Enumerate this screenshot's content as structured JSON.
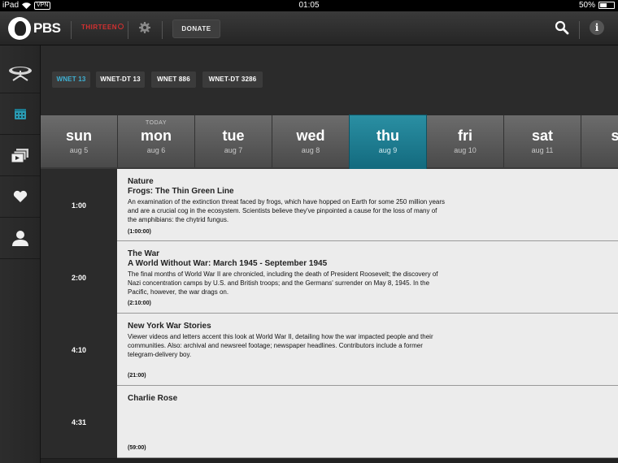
{
  "status_bar": {
    "device": "iPad",
    "vpn": "VPN",
    "time": "01:05",
    "battery": "50%",
    "battery_level": 0.5
  },
  "header": {
    "logo_text": "PBS",
    "station_logo": "THIRTEEN",
    "donate_label": "DONATE",
    "icons": [
      "pbs-head-icon",
      "gear-icon",
      "search-icon",
      "info-icon"
    ]
  },
  "sidebar": {
    "items": [
      {
        "icon": "satellite-dish-icon"
      },
      {
        "icon": "calendar-icon",
        "active": true
      },
      {
        "icon": "video-stack-icon"
      },
      {
        "icon": "heart-icon"
      },
      {
        "icon": "person-icon"
      }
    ]
  },
  "channels": [
    {
      "label": "WNET 13",
      "active": true
    },
    {
      "label": "WNET-DT 13",
      "active": false
    },
    {
      "label": "WNET 886",
      "active": false
    },
    {
      "label": "WNET-DT 3286",
      "active": false
    }
  ],
  "days": [
    {
      "name": "sun",
      "date": "aug 5",
      "today": ""
    },
    {
      "name": "mon",
      "date": "aug 6",
      "today": "TODAY"
    },
    {
      "name": "tue",
      "date": "aug 7",
      "today": ""
    },
    {
      "name": "wed",
      "date": "aug 8",
      "today": ""
    },
    {
      "name": "thu",
      "date": "aug 9",
      "today": "",
      "selected": true
    },
    {
      "name": "fri",
      "date": "aug 10",
      "today": ""
    },
    {
      "name": "sat",
      "date": "aug 11",
      "today": ""
    },
    {
      "name": "su",
      "date": "",
      "today": ""
    }
  ],
  "listings": [
    {
      "time": "1:00",
      "title": "Nature",
      "episode": "Frogs: The Thin Green Line",
      "description": "An examination of the extinction threat faced by frogs, which have hopped on Earth for some 250 million years and are a crucial cog in the ecosystem. Scientists believe they've pinpointed a cause for the loss of many of the amphibians: the chytrid fungus.",
      "duration": "(1:00:00)"
    },
    {
      "time": "2:00",
      "title": "The War",
      "episode": "A World Without War: March 1945 - September 1945",
      "description": "The final months of World War II are chronicled, including the death of President Roosevelt; the discovery of Nazi concentration camps by U.S. and British troops; and the Germans' surrender on May 8, 1945. In the Pacific, however, the war drags on.",
      "duration": "(2:10:00)"
    },
    {
      "time": "4:10",
      "title": "New York War Stories",
      "episode": "",
      "description": "Viewer videos and letters accent this look at World War II, detailing how the war impacted people and their communities. Also: archival and newsreel footage; newspaper headlines. Contributors include a former telegram-delivery boy.",
      "duration": "(21:00)"
    },
    {
      "time": "4:31",
      "title": "Charlie Rose",
      "episode": "",
      "description": "",
      "duration": "(59:00)"
    }
  ],
  "colors": {
    "accent": "#1f7f93",
    "channel_active": "#3fb2d5",
    "station_red": "#d43030"
  }
}
